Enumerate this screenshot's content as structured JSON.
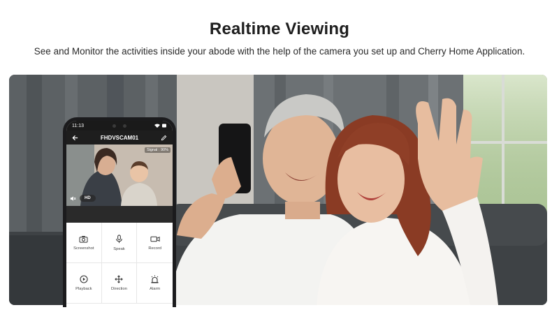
{
  "header": {
    "title": "Realtime Viewing",
    "subtitle": "See and Monitor the activities inside your abode with the help of the camera you set up and Cherry Home Application."
  },
  "phone": {
    "status_time": "11:13",
    "camera_name": "FHDVSCAM01",
    "signal": "Signal : 90%",
    "quality": "HD",
    "actions": [
      {
        "label": "Screenshot",
        "icon": "camera-icon"
      },
      {
        "label": "Speak",
        "icon": "microphone-icon"
      },
      {
        "label": "Record",
        "icon": "video-record-icon"
      },
      {
        "label": "Playback",
        "icon": "playback-icon"
      },
      {
        "label": "Direction",
        "icon": "direction-arrows-icon"
      },
      {
        "label": "Alarm",
        "icon": "alarm-siren-icon"
      }
    ]
  },
  "colors": {
    "background": "#ffffff",
    "title": "#1e1e1e",
    "phone_frame": "#1b1b1d",
    "app_bar": "#1e1e1e"
  }
}
